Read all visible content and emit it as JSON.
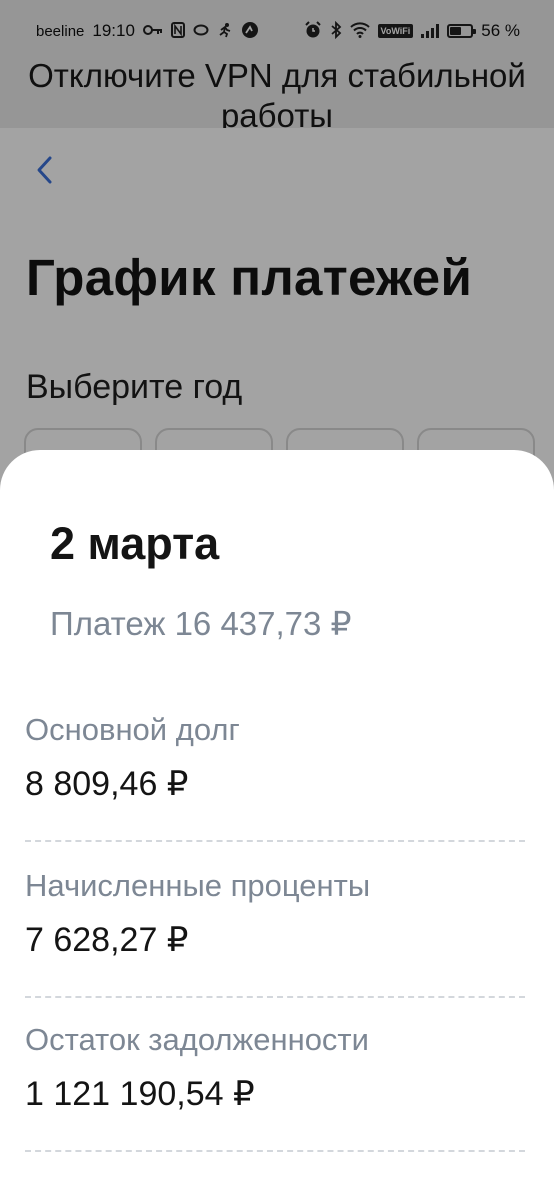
{
  "status_bar": {
    "carrier": "beeline",
    "time": "19:10",
    "icons": [
      "key-icon",
      "nfc-icon",
      "loop-icon",
      "runner-icon",
      "speedometer-icon",
      "alarm-icon",
      "bluetooth-icon",
      "wifi-icon"
    ],
    "vowifi": "VoWiFi",
    "battery_percent": "56 %",
    "battery_level": 0.56
  },
  "vpn_banner": {
    "text": "Отключите VPN для стабильной работы"
  },
  "page": {
    "back_icon": "chevron-left-icon",
    "title": "График платежей",
    "year_label": "Выберите год",
    "year_chips_count": 4
  },
  "sheet": {
    "date": "2 марта",
    "payment": "Платеж 16 437,73 ₽",
    "rows": [
      {
        "label": "Основной долг",
        "value": "8 809,46 ₽"
      },
      {
        "label": "Начисленные проценты",
        "value": "7 628,27 ₽"
      },
      {
        "label": "Остаток задолженности",
        "value": "1 121 190,54 ₽"
      }
    ]
  },
  "colors": {
    "accent": "#3a6fd8",
    "secondary_text": "#7d8794",
    "primary_text": "#141414",
    "divider": "#d3d7dc"
  }
}
